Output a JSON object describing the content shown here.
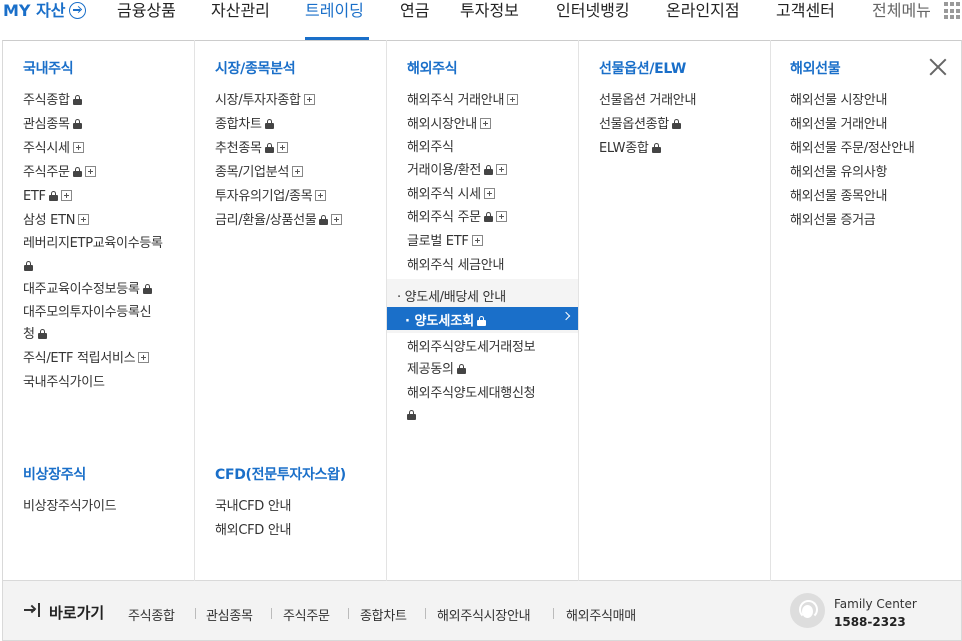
{
  "nav": {
    "items": [
      "MY 자산",
      "금융상품",
      "자산관리",
      "트레이딩",
      "연금",
      "투자정보",
      "인터넷뱅킹",
      "온라인지점",
      "고객센터",
      "전체메뉴"
    ]
  },
  "domestic": {
    "title": "국내주식",
    "items": [
      "주식종합",
      "관심종목",
      "주식시세",
      "주식주문",
      "ETF",
      "삼성 ETN",
      "레버리지ETP교육이수등록",
      "대주교육이수정보등록",
      "대주모의투자이수등록신",
      "청",
      "주식/ETF 적립서비스",
      "국내주식가이드"
    ]
  },
  "unlisted": {
    "title": "비상장주식",
    "items": [
      "비상장주식가이드"
    ]
  },
  "market": {
    "title": "시장/종목분석",
    "items": [
      "시장/투자자종합",
      "종합차트",
      "추천종목",
      "종목/기업분석",
      "투자유의기업/종목",
      "금리/환율/상품선물"
    ]
  },
  "cfd": {
    "title": "CFD(전문투자자스왑)",
    "items": [
      "국내CFD 안내",
      "해외CFD 안내"
    ]
  },
  "overseas": {
    "title": "해외주식",
    "items": [
      "해외주식 거래안내",
      "해외시장안내",
      "해외주식",
      "거래이용/환전",
      "해외주식 시세",
      "해외주식 주문",
      "글로벌 ETF",
      "해외주식 세금안내"
    ],
    "sub": [
      "· 양도세/배당세 안내",
      "· 양도세조회"
    ],
    "after": [
      "해외주식양도세거래정보",
      "제공동의",
      "해외주식양도세대행신청"
    ]
  },
  "futures": {
    "title": "선물옵션/ELW",
    "items": [
      "선물옵션 거래안내",
      "선물옵션종합",
      "ELW종합"
    ]
  },
  "ovfutures": {
    "title": "해외선물",
    "items": [
      "해외선물 시장안내",
      "해외선물 거래안내",
      "해외선물 주문/정산안내",
      "해외선물 유의사항",
      "해외선물 종목안내",
      "해외선물 증거금"
    ]
  },
  "bottom": {
    "title": "바로가기",
    "links": [
      "주식종합",
      "관심종목",
      "주식주문",
      "종합차트",
      "해외주식시장안내",
      "해외주식매매"
    ],
    "center_name": "Family Center",
    "center_phone": "1588-2323"
  },
  "colors": {
    "accent": "#1a6fc9"
  }
}
